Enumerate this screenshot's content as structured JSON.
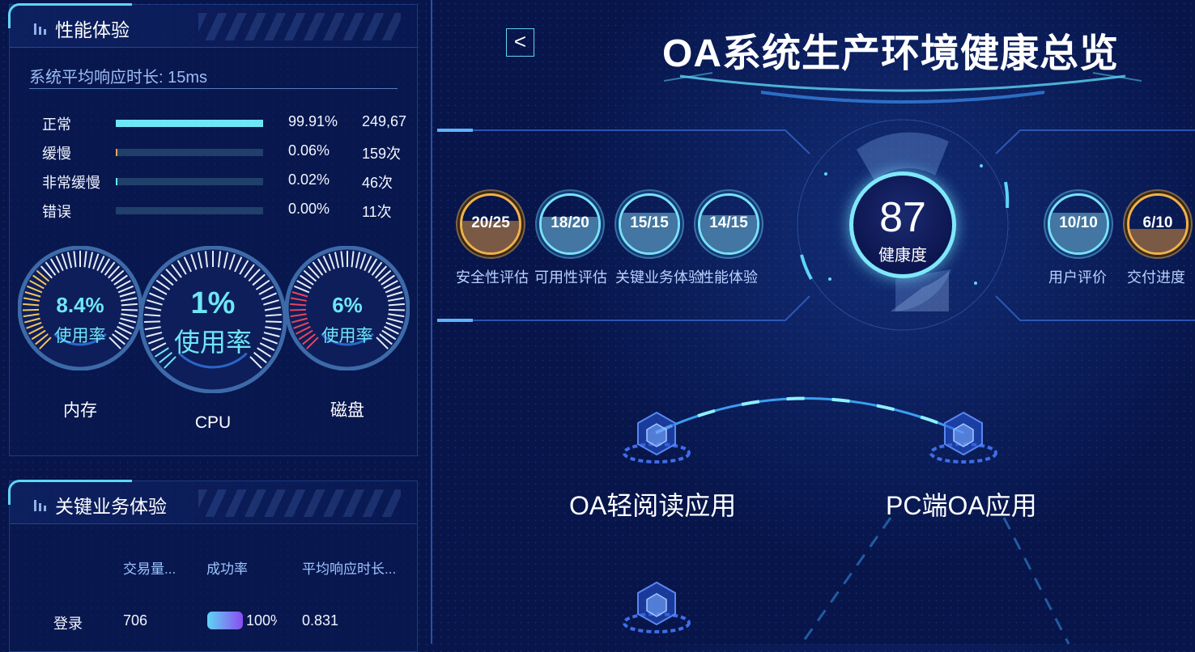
{
  "header": {
    "back_icon": "chevron-left-icon",
    "title": "OA系统生产环境健康总览"
  },
  "performance": {
    "title": "性能体验",
    "avg_response": "系统平均响应时长: 15ms",
    "rows": [
      {
        "label": "正常",
        "percent": "99.91%",
        "count": "249,67",
        "fill": 0.9991
      },
      {
        "label": "缓慢",
        "percent": "0.06%",
        "count": "159次",
        "fill": 0.0006
      },
      {
        "label": "非常缓慢",
        "percent": "0.02%",
        "count": "46次",
        "fill": 0.0002
      },
      {
        "label": "错误",
        "percent": "0.00%",
        "count": "11次",
        "fill": 0.0
      }
    ],
    "gauges": [
      {
        "name": "内存",
        "value": "8.4%",
        "sub": "使用率",
        "level": 0.084,
        "accent": "#f2c55c"
      },
      {
        "name": "CPU",
        "value": "1%",
        "sub": "使用率",
        "level": 0.01,
        "accent": "#6ee6f6"
      },
      {
        "name": "磁盘",
        "value": "6%",
        "sub": "使用率",
        "level": 0.06,
        "accent": "#e8455a"
      }
    ]
  },
  "key_business": {
    "title": "关键业务体验",
    "columns": [
      "交易量...",
      "成功率",
      "平均响应时长..."
    ],
    "rows": [
      {
        "name": "登录",
        "volume": "706",
        "success": "100%",
        "avg": "0.831",
        "success_level": 1.0
      }
    ]
  },
  "scores_left": [
    {
      "score": "20/25",
      "label": "安全性评估",
      "level": 0.8,
      "status": "warn"
    },
    {
      "score": "18/20",
      "label": "可用性评估",
      "level": 0.9,
      "status": "ok"
    },
    {
      "score": "15/15",
      "label": "关键业务体验",
      "level": 1.0,
      "status": "ok"
    },
    {
      "score": "14/15",
      "label": "性能体验",
      "level": 0.93,
      "status": "ok"
    }
  ],
  "scores_right": [
    {
      "score": "10/10",
      "label": "用户评价",
      "level": 1.0,
      "status": "ok"
    },
    {
      "score": "6/10",
      "label": "交付进度",
      "level": 0.6,
      "status": "warn"
    }
  ],
  "health": {
    "score": "87",
    "label": "健康度"
  },
  "apps": [
    {
      "name": "OA轻阅读应用",
      "icon": "cube-icon"
    },
    {
      "name": "PC端OA应用",
      "icon": "cube-icon"
    },
    {
      "name": "",
      "icon": "cube-icon"
    }
  ],
  "colors": {
    "accent": "#6ee6f6",
    "warning": "#f0b14d",
    "danger": "#e8455a",
    "background": "#07154a"
  }
}
